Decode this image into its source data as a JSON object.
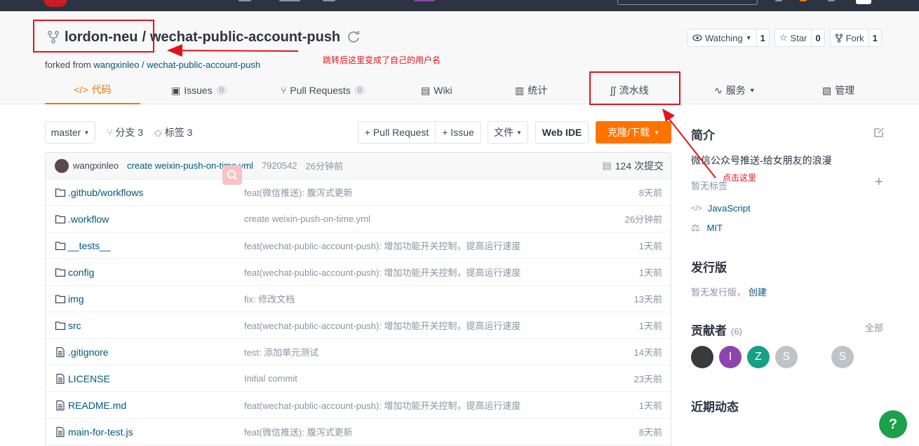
{
  "repo": {
    "owner": "lordon-neu",
    "separator": "/",
    "name": "wechat-public-account-push",
    "forked_from_prefix": "forked from",
    "forked_from_link": "wangxinleo / wechat-public-account-push"
  },
  "actions": {
    "watch_label": "Watching",
    "watch_count": "1",
    "star_label": "Star",
    "star_count": "0",
    "fork_label": "Fork",
    "fork_count": "1"
  },
  "tabs": [
    {
      "label": "代码",
      "icon": "code-icon"
    },
    {
      "label": "Issues",
      "badge": "0",
      "icon": "issues-icon"
    },
    {
      "label": "Pull Requests",
      "badge": "0",
      "icon": "pull-request-icon"
    },
    {
      "label": "Wiki",
      "icon": "wiki-icon"
    },
    {
      "label": "统计",
      "icon": "stats-icon"
    },
    {
      "label": "流水线",
      "icon": "pipeline-icon"
    },
    {
      "label": "服务",
      "icon": "service-icon"
    },
    {
      "label": "管理",
      "icon": "manage-icon"
    }
  ],
  "toolbar": {
    "branch": "master",
    "branches": "分支 3",
    "tags": "标签 3",
    "new_pr": "+ Pull Request",
    "new_issue": "+ Issue",
    "file_menu": "文件",
    "web_ide": "Web IDE",
    "clone": "克隆/下载"
  },
  "latest_commit": {
    "author": "wangxinleo",
    "message": "create weixin-push-on-time.yml",
    "sha": "7920542",
    "time": "26分钟前",
    "count": "124 次提交"
  },
  "files": [
    {
      "name": ".github/workflows",
      "type": "folder",
      "message": "feat(微信推送): 腹泻式更新",
      "time": "8天前"
    },
    {
      "name": ".workflow",
      "type": "folder",
      "message": "create weixin-push-on-time.yml",
      "time": "26分钟前"
    },
    {
      "name": "__tests__",
      "type": "folder",
      "message": "feat(wechat-public-account-push): 增加功能开关控制，提高运行速度",
      "time": "1天前"
    },
    {
      "name": "config",
      "type": "folder",
      "message": "feat(wechat-public-account-push): 增加功能开关控制，提高运行速度",
      "time": "1天前"
    },
    {
      "name": "img",
      "type": "folder",
      "message": "fix: 修改文档",
      "time": "13天前"
    },
    {
      "name": "src",
      "type": "folder",
      "message": "feat(wechat-public-account-push): 增加功能开关控制，提高运行速度",
      "time": "1天前"
    },
    {
      "name": ".gitignore",
      "type": "file",
      "message": "test: 添加单元测试",
      "time": "14天前"
    },
    {
      "name": "LICENSE",
      "type": "file",
      "message": "Initial commit",
      "time": "23天前"
    },
    {
      "name": "README.md",
      "type": "file",
      "message": "feat(wechat-public-account-push): 增加功能开关控制，提高运行速度",
      "time": "1天前"
    },
    {
      "name": "main-for-test.js",
      "type": "file",
      "message": "feat(微信推送): 腹泻式更新",
      "time": "8天前"
    }
  ],
  "sidebar": {
    "intro_title": "简介",
    "intro_text": "微信公众号推送-给女朋友的浪漫",
    "no_tags": "暂无标签",
    "language": "JavaScript",
    "license": "MIT",
    "releases_title": "发行版",
    "no_releases": "暂无发行版，",
    "create_link": "创建",
    "contributors_title": "贡献者",
    "contributors_count": "(6)",
    "all_link": "全部",
    "contributors": [
      {
        "initial": "",
        "color": "#3a3a3a"
      },
      {
        "initial": "I",
        "color": "#8e44ad"
      },
      {
        "initial": "Z",
        "color": "#16a085"
      },
      {
        "initial": "S",
        "color": "#bdc3c7"
      },
      {
        "initial": "",
        "color": "#ffffff"
      },
      {
        "initial": "S",
        "color": "#bdc3c7"
      }
    ],
    "activity_title": "近期动态"
  },
  "annotations": {
    "username_note": "跳转后这里变成了自己的用户名",
    "click_note": "点击这里"
  },
  "help": "?",
  "colors": {
    "accent": "#fe7300",
    "link": "#005980",
    "annotation": "#e0141e"
  }
}
